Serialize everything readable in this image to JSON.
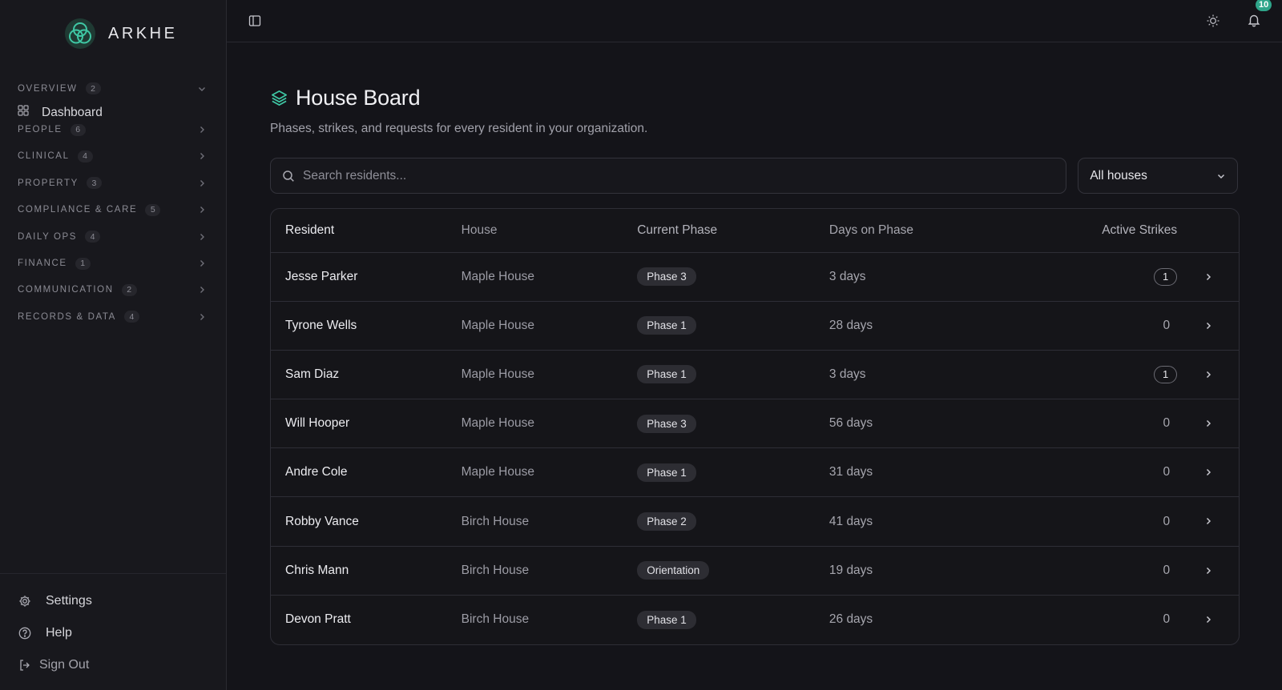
{
  "brand": {
    "name": "ARKHE"
  },
  "sidebar": {
    "groups": [
      {
        "label": "OVERVIEW",
        "count": "2",
        "expanded": true
      },
      {
        "label": "PEOPLE",
        "count": "6"
      },
      {
        "label": "CLINICAL",
        "count": "4"
      },
      {
        "label": "PROPERTY",
        "count": "3"
      },
      {
        "label": "COMPLIANCE & CARE",
        "count": "5"
      },
      {
        "label": "DAILY OPS",
        "count": "4"
      },
      {
        "label": "FINANCE",
        "count": "1"
      },
      {
        "label": "COMMUNICATION",
        "count": "2"
      },
      {
        "label": "RECORDS & DATA",
        "count": "4"
      }
    ],
    "overview_item": "Dashboard",
    "bottom": {
      "settings": "Settings",
      "help": "Help",
      "sign_out": "Sign Out"
    }
  },
  "topbar": {
    "notification_count": "10"
  },
  "page": {
    "title": "House Board",
    "subtitle": "Phases, strikes, and requests for every resident in your organization."
  },
  "search": {
    "placeholder": "Search residents..."
  },
  "house_filter": {
    "selected": "All houses"
  },
  "table": {
    "headers": {
      "resident": "Resident",
      "house": "House",
      "phase": "Current Phase",
      "days": "Days on Phase",
      "strikes": "Active Strikes"
    },
    "rows": [
      {
        "resident": "Jesse Parker",
        "house": "Maple House",
        "phase": "Phase 3",
        "days": "3 days",
        "strikes": "1"
      },
      {
        "resident": "Tyrone Wells",
        "house": "Maple House",
        "phase": "Phase 1",
        "days": "28 days",
        "strikes": "0"
      },
      {
        "resident": "Sam Diaz",
        "house": "Maple House",
        "phase": "Phase 1",
        "days": "3 days",
        "strikes": "1"
      },
      {
        "resident": "Will Hooper",
        "house": "Maple House",
        "phase": "Phase 3",
        "days": "56 days",
        "strikes": "0"
      },
      {
        "resident": "Andre Cole",
        "house": "Maple House",
        "phase": "Phase 1",
        "days": "31 days",
        "strikes": "0"
      },
      {
        "resident": "Robby Vance",
        "house": "Birch House",
        "phase": "Phase 2",
        "days": "41 days",
        "strikes": "0"
      },
      {
        "resident": "Chris Mann",
        "house": "Birch House",
        "phase": "Orientation",
        "days": "19 days",
        "strikes": "0"
      },
      {
        "resident": "Devon Pratt",
        "house": "Birch House",
        "phase": "Phase 1",
        "days": "26 days",
        "strikes": "0"
      }
    ]
  },
  "colors": {
    "accent": "#2fa58a",
    "background": "#141419",
    "sidebar": "#18181d"
  },
  "icons": [
    "logo-icon",
    "dashboard-icon",
    "chevron-right-icon",
    "chevron-down-icon",
    "sidebar-toggle-icon",
    "sun-icon",
    "bell-icon",
    "layers-icon",
    "search-icon",
    "gear-icon",
    "help-icon",
    "sign-out-icon"
  ]
}
